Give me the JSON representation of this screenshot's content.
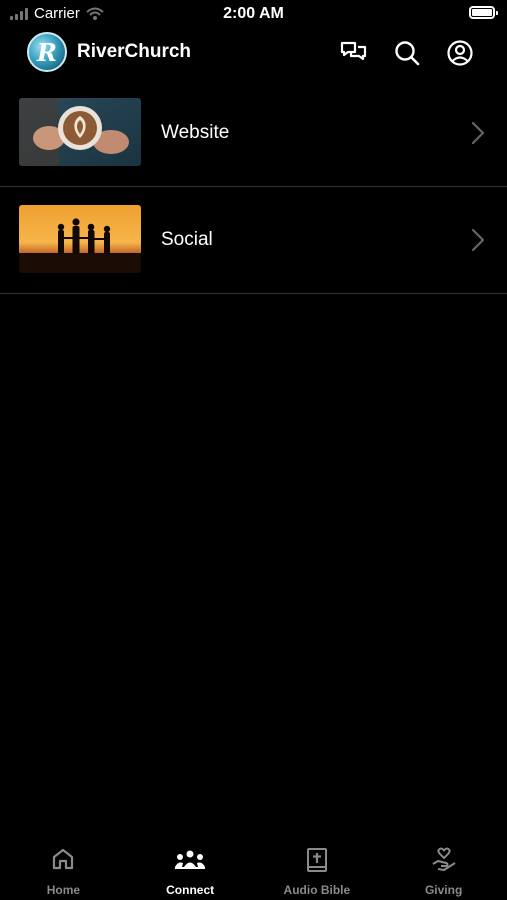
{
  "status_bar": {
    "carrier": "Carrier",
    "time": "2:00 AM"
  },
  "header": {
    "title": "RiverChurch",
    "logo_letter": "R"
  },
  "header_icons": [
    "chat-icon",
    "search-icon",
    "profile-icon"
  ],
  "list": [
    {
      "label": "Website",
      "thumbnail": "latte-art-photo"
    },
    {
      "label": "Social",
      "thumbnail": "sunset-silhouette-photo"
    }
  ],
  "tabs": [
    {
      "label": "Home",
      "icon": "home-icon",
      "active": false
    },
    {
      "label": "Connect",
      "icon": "people-icon",
      "active": true
    },
    {
      "label": "Audio Bible",
      "icon": "bible-icon",
      "active": false
    },
    {
      "label": "Giving",
      "icon": "giving-hand-icon",
      "active": false
    }
  ],
  "colors": {
    "background": "#000000",
    "text": "#ffffff",
    "inactive_tab": "#8a8a8a",
    "divider": "#333333"
  }
}
